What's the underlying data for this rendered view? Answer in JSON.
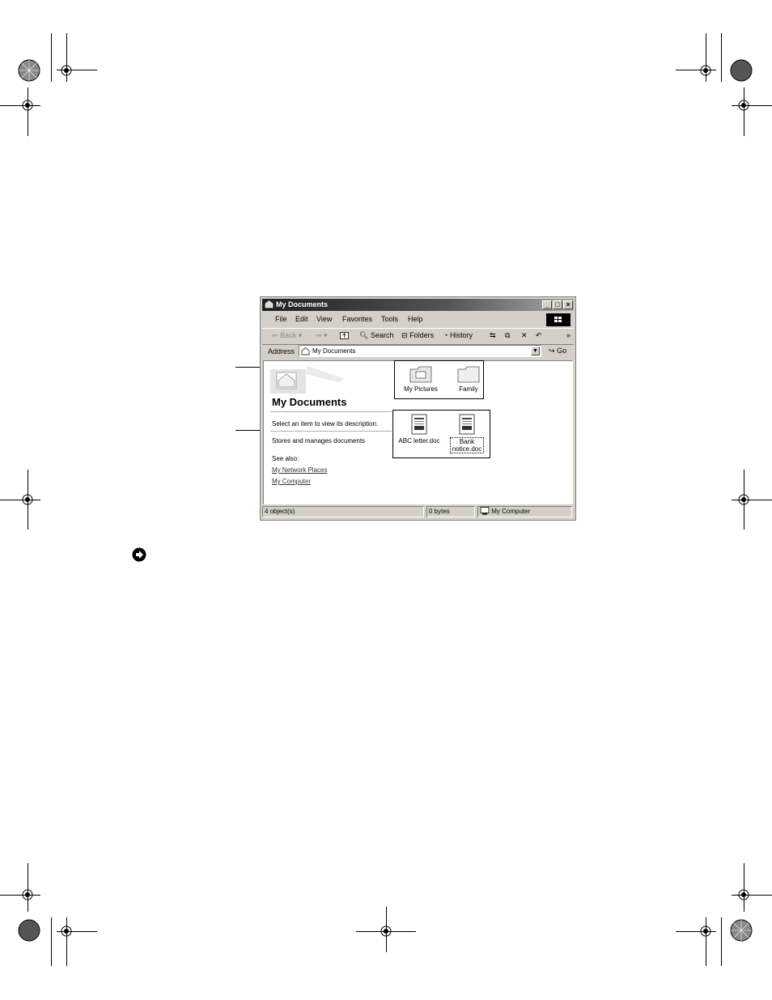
{
  "window": {
    "title": "My Documents",
    "buttons": {
      "minimize": "_",
      "maximize": "□",
      "close": "×"
    }
  },
  "menu": {
    "items": [
      {
        "label": "File"
      },
      {
        "label": "Edit"
      },
      {
        "label": "View"
      },
      {
        "label": "Favorites"
      },
      {
        "label": "Tools"
      },
      {
        "label": "Help"
      }
    ]
  },
  "toolbar": {
    "back": "Back",
    "search": "Search",
    "folders": "Folders",
    "history": "History",
    "more": "»"
  },
  "address": {
    "label": "Address",
    "value": "My Documents",
    "go": "Go"
  },
  "panel": {
    "title": "My Documents",
    "select_prompt": "Select an item to view its description.",
    "description": "Stores and manages documents",
    "see_also": "See also:",
    "links": [
      "My Network Places",
      "My Computer"
    ]
  },
  "files": [
    {
      "name": "My Pictures",
      "type": "pictures-folder"
    },
    {
      "name": "Family",
      "type": "folder"
    },
    {
      "name": "ABC letter.doc",
      "type": "document"
    },
    {
      "name": "Bank notice.doc",
      "type": "document"
    }
  ],
  "status": {
    "objects": "4 object(s)",
    "size": "0 bytes",
    "zone": "My Computer"
  },
  "colors": {
    "titlebar_dark": "#202020",
    "chrome": "#d4d0c8"
  }
}
